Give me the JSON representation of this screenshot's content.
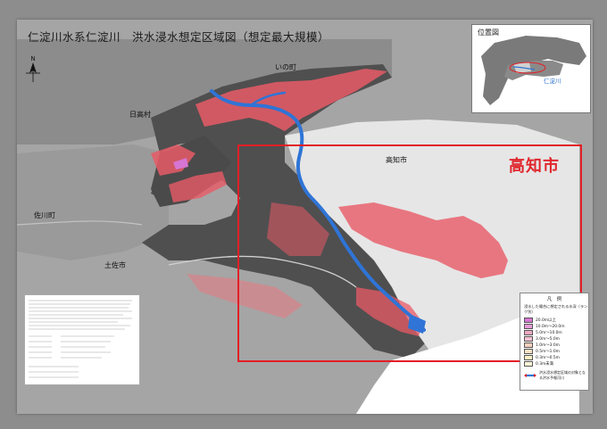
{
  "map": {
    "title": "仁淀川水系仁淀川　洪水浸水想定区域図（想定最大規模）",
    "places": {
      "ino": "いの町",
      "hidaka": "日高村",
      "kochi_small": "高知市",
      "sakawa": "佐川町",
      "tosa": "土佐市"
    },
    "focus_label": "高知市",
    "compass_label": "N"
  },
  "location_map": {
    "title": "位置図",
    "river_label": "仁淀川"
  },
  "legend": {
    "title": "凡　例",
    "subtitle": "浸水した場合に想定される水深（ランク別）",
    "items": [
      {
        "label": "20.0m以上",
        "color": "#d775d3"
      },
      {
        "label": "10.0m〜20.0m",
        "color": "#e69ad9"
      },
      {
        "label": "5.0m〜10.0m",
        "color": "#f0a8c2"
      },
      {
        "label": "3.0m〜5.0m",
        "color": "#f7c1d2"
      },
      {
        "label": "1.0m〜3.0m",
        "color": "#fad0bf"
      },
      {
        "label": "0.5m〜1.0m",
        "color": "#fbe3c3"
      },
      {
        "label": "0.3m〜0.5m",
        "color": "#fdf0c7"
      },
      {
        "label": "0.3m未満",
        "color": "#fff8d8"
      }
    ],
    "footer": "洪水浸水想定区域の対象となる洪水予報河川"
  },
  "colors": {
    "flood": "#e85a66",
    "river": "#2f74d6",
    "focus_frame": "#e21f26",
    "terrain": "#5d5d5d"
  }
}
